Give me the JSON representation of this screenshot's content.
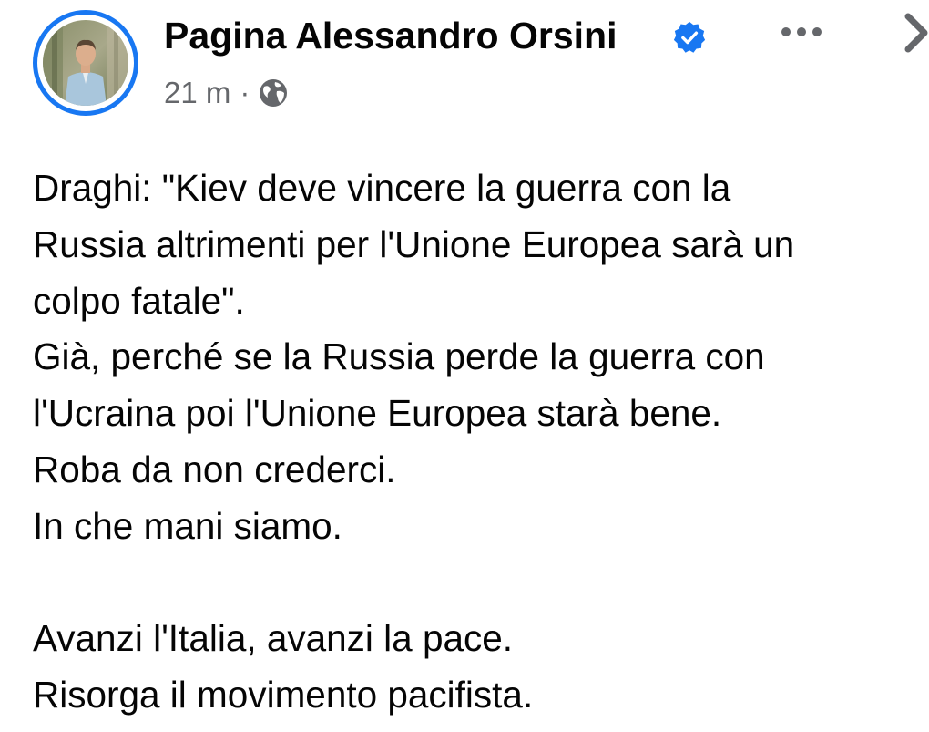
{
  "post": {
    "page_name": "Pagina Alessandro Orsini",
    "verified": true,
    "time": "21 m",
    "separator": "·",
    "audience_icon": "globe-icon",
    "body_lines": [
      "Draghi: \"Kiev deve vincere la guerra con la",
      "Russia altrimenti per l'Unione Europea sarà un",
      "colpo fatale\".",
      "Già, perché se la Russia perde la guerra con",
      "l'Ucraina poi l'Unione Europea starà bene.",
      "Roba da non crederci.",
      "In che mani siamo.",
      "",
      "Avanzi l'Italia, avanzi la pace.",
      "Risorga il movimento pacifista."
    ]
  },
  "icons": {
    "verified": "verified-badge-icon",
    "more": "more-options-icon",
    "next": "chevron-right-icon"
  },
  "colors": {
    "accent": "#1877f2",
    "text": "#050505",
    "secondary_text": "#65676b"
  }
}
